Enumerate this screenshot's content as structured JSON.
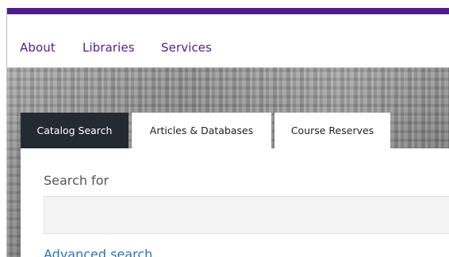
{
  "nav": {
    "items": [
      {
        "label": "About"
      },
      {
        "label": "Libraries"
      },
      {
        "label": "Services"
      }
    ]
  },
  "search": {
    "tabs": [
      {
        "label": "Catalog Search",
        "active": true
      },
      {
        "label": "Articles & Databases",
        "active": false
      },
      {
        "label": "Course Reserves",
        "active": false
      }
    ],
    "label": "Search for",
    "value": "",
    "advanced_link": "Advanced search"
  },
  "colors": {
    "brand": "#4e1f8c",
    "active_tab": "#232a31",
    "link": "#2a73b8"
  }
}
